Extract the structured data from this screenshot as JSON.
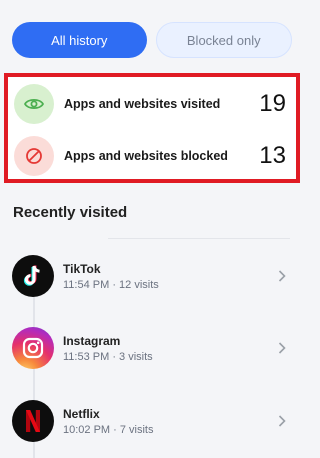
{
  "tabs": [
    {
      "label": "All history",
      "active": true
    },
    {
      "label": "Blocked only",
      "active": false
    }
  ],
  "summary": {
    "visited": {
      "label": "Apps and websites visited",
      "count": "19",
      "icon": "eye-icon",
      "color": "#4caf50"
    },
    "blocked": {
      "label": "Apps and websites blocked",
      "count": "13",
      "icon": "block-icon",
      "color": "#e53935"
    }
  },
  "recent": {
    "title": "Recently visited",
    "items": [
      {
        "name": "TikTok",
        "meta": "11:54 PM · 12 visits",
        "icon": "tiktok-icon"
      },
      {
        "name": "Instagram",
        "meta": "11:53 PM · 3 visits",
        "icon": "instagram-icon"
      },
      {
        "name": "Netflix",
        "meta": "10:02 PM · 7 visits",
        "icon": "netflix-icon"
      }
    ]
  }
}
